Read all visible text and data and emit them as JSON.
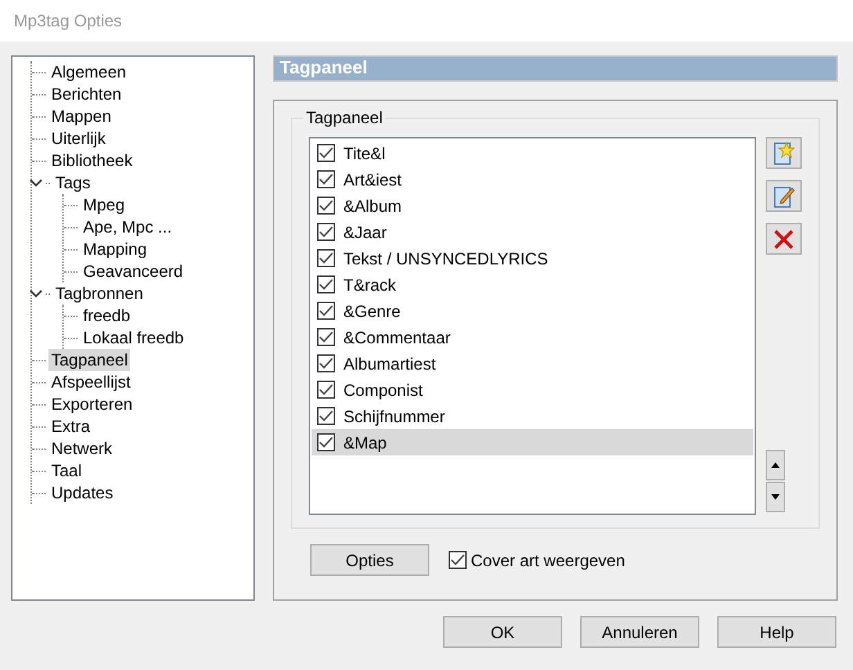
{
  "window": {
    "title": "Mp3tag Opties"
  },
  "tree": [
    {
      "label": "Algemeen",
      "selected": false
    },
    {
      "label": "Berichten",
      "selected": false
    },
    {
      "label": "Mappen",
      "selected": false
    },
    {
      "label": "Uiterlijk",
      "selected": false
    },
    {
      "label": "Bibliotheek",
      "selected": false
    },
    {
      "label": "Tags",
      "selected": false,
      "expanded": true,
      "children": [
        {
          "label": "Mpeg",
          "selected": false
        },
        {
          "label": "Ape, Mpc ...",
          "selected": false
        },
        {
          "label": "Mapping",
          "selected": false
        },
        {
          "label": "Geavanceerd",
          "selected": false
        }
      ]
    },
    {
      "label": "Tagbronnen",
      "selected": false,
      "expanded": true,
      "children": [
        {
          "label": "freedb",
          "selected": false
        },
        {
          "label": "Lokaal freedb",
          "selected": false
        }
      ]
    },
    {
      "label": "Tagpaneel",
      "selected": true
    },
    {
      "label": "Afspeellijst",
      "selected": false
    },
    {
      "label": "Exporteren",
      "selected": false
    },
    {
      "label": "Extra",
      "selected": false
    },
    {
      "label": "Netwerk",
      "selected": false
    },
    {
      "label": "Taal",
      "selected": false
    },
    {
      "label": "Updates",
      "selected": false
    }
  ],
  "page_header": "Tagpaneel",
  "group": {
    "title": "Tagpaneel",
    "fields": [
      {
        "label": "Tite&l",
        "checked": true,
        "selected": false
      },
      {
        "label": "Art&iest",
        "checked": true,
        "selected": false
      },
      {
        "label": "&Album",
        "checked": true,
        "selected": false
      },
      {
        "label": "&Jaar",
        "checked": true,
        "selected": false
      },
      {
        "label": "Tekst / UNSYNCEDLYRICS",
        "checked": true,
        "selected": false
      },
      {
        "label": "T&rack",
        "checked": true,
        "selected": false
      },
      {
        "label": "&Genre",
        "checked": true,
        "selected": false
      },
      {
        "label": "&Commentaar",
        "checked": true,
        "selected": false
      },
      {
        "label": "Albumartiest",
        "checked": true,
        "selected": false
      },
      {
        "label": "Componist",
        "checked": true,
        "selected": false
      },
      {
        "label": "Schijfnummer",
        "checked": true,
        "selected": false
      },
      {
        "label": "&Map",
        "checked": true,
        "selected": true
      }
    ]
  },
  "options_button": "Opties",
  "cover_art": {
    "label": "Cover art weergeven",
    "checked": true
  },
  "buttons": [
    "OK",
    "Annuleren",
    "Help"
  ]
}
